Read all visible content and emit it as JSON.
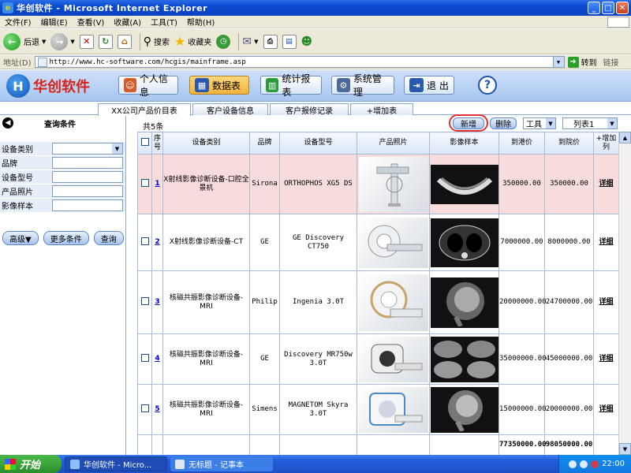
{
  "window": {
    "title": "华创软件 - Microsoft Internet Explorer"
  },
  "menu": [
    "文件(F)",
    "编辑(E)",
    "查看(V)",
    "收藏(A)",
    "工具(T)",
    "帮助(H)"
  ],
  "toolbar": {
    "back": "后退",
    "search": "搜索",
    "favorites": "收藏夹"
  },
  "address": {
    "label": "地址(D)",
    "url": "http://www.hc-software.com/hcgis/mainframe.asp",
    "go": "转到",
    "links": "链接"
  },
  "app": {
    "logo_text": "华创软件",
    "nav": {
      "personal": "个人信息",
      "data": "数据表",
      "stats": "统计报表",
      "system": "系统管理",
      "exit": "退 出",
      "help": "?"
    }
  },
  "tabs": [
    "XX公司产品价目表",
    "客户设备信息",
    "客户报修记录",
    "+增加表"
  ],
  "sidebar": {
    "title": "查询条件",
    "filters": [
      "设备类别",
      "品牌",
      "设备型号",
      "产品照片",
      "影像样本"
    ],
    "buttons": {
      "advanced": "高级▼",
      "more": "更多条件",
      "query": "查询"
    }
  },
  "main": {
    "count": "共5条",
    "add": "新增",
    "delete": "删除",
    "tools": "工具",
    "list": "列表1",
    "headers": [
      "序号",
      "设备类别",
      "品牌",
      "设备型号",
      "产品照片",
      "影像样本",
      "到港价",
      "到院价",
      "+增加列"
    ],
    "rows": [
      {
        "no": "1",
        "category": "X射线影像诊断设备-口腔全景机",
        "brand": "Sirona",
        "model": "ORTHOPHOS XG5 DS",
        "port_price": "350000.00",
        "hospital_price": "350000.00",
        "detail": "详细"
      },
      {
        "no": "2",
        "category": "X射线影像诊断设备-CT",
        "brand": "GE",
        "model": "GE Discovery CT750",
        "port_price": "7000000.00",
        "hospital_price": "8000000.00",
        "detail": "详细"
      },
      {
        "no": "3",
        "category": "核磁共振影像诊断设备-MRI",
        "brand": "Philip",
        "model": "Ingenia 3.0T",
        "port_price": "20000000.00",
        "hospital_price": "24700000.00",
        "detail": "详细"
      },
      {
        "no": "4",
        "category": "核磁共振影像诊断设备-MRI",
        "brand": "GE",
        "model": "Discovery MR750w 3.0T",
        "port_price": "35000000.00",
        "hospital_price": "45000000.00",
        "detail": "详细"
      },
      {
        "no": "5",
        "category": "核磁共振影像诊断设备-MRI",
        "brand": "Simens",
        "model": "MAGNETOM Skyra 3.0T",
        "port_price": "15000000.00",
        "hospital_price": "20000000.00",
        "detail": "详细"
      }
    ],
    "totals": {
      "port_price": "77350000.00",
      "hospital_price": "98050000.00"
    }
  },
  "taskbar": {
    "start": "开始",
    "task1": "华创软件 - Micro...",
    "task2": "无标题 - 记事本",
    "clock": "22:00"
  },
  "colors": {
    "title_blue": "#0a4ad0",
    "logo_red": "#d6231a",
    "row_highlight": "#f8dcdc",
    "add_ring": "#e03030"
  }
}
